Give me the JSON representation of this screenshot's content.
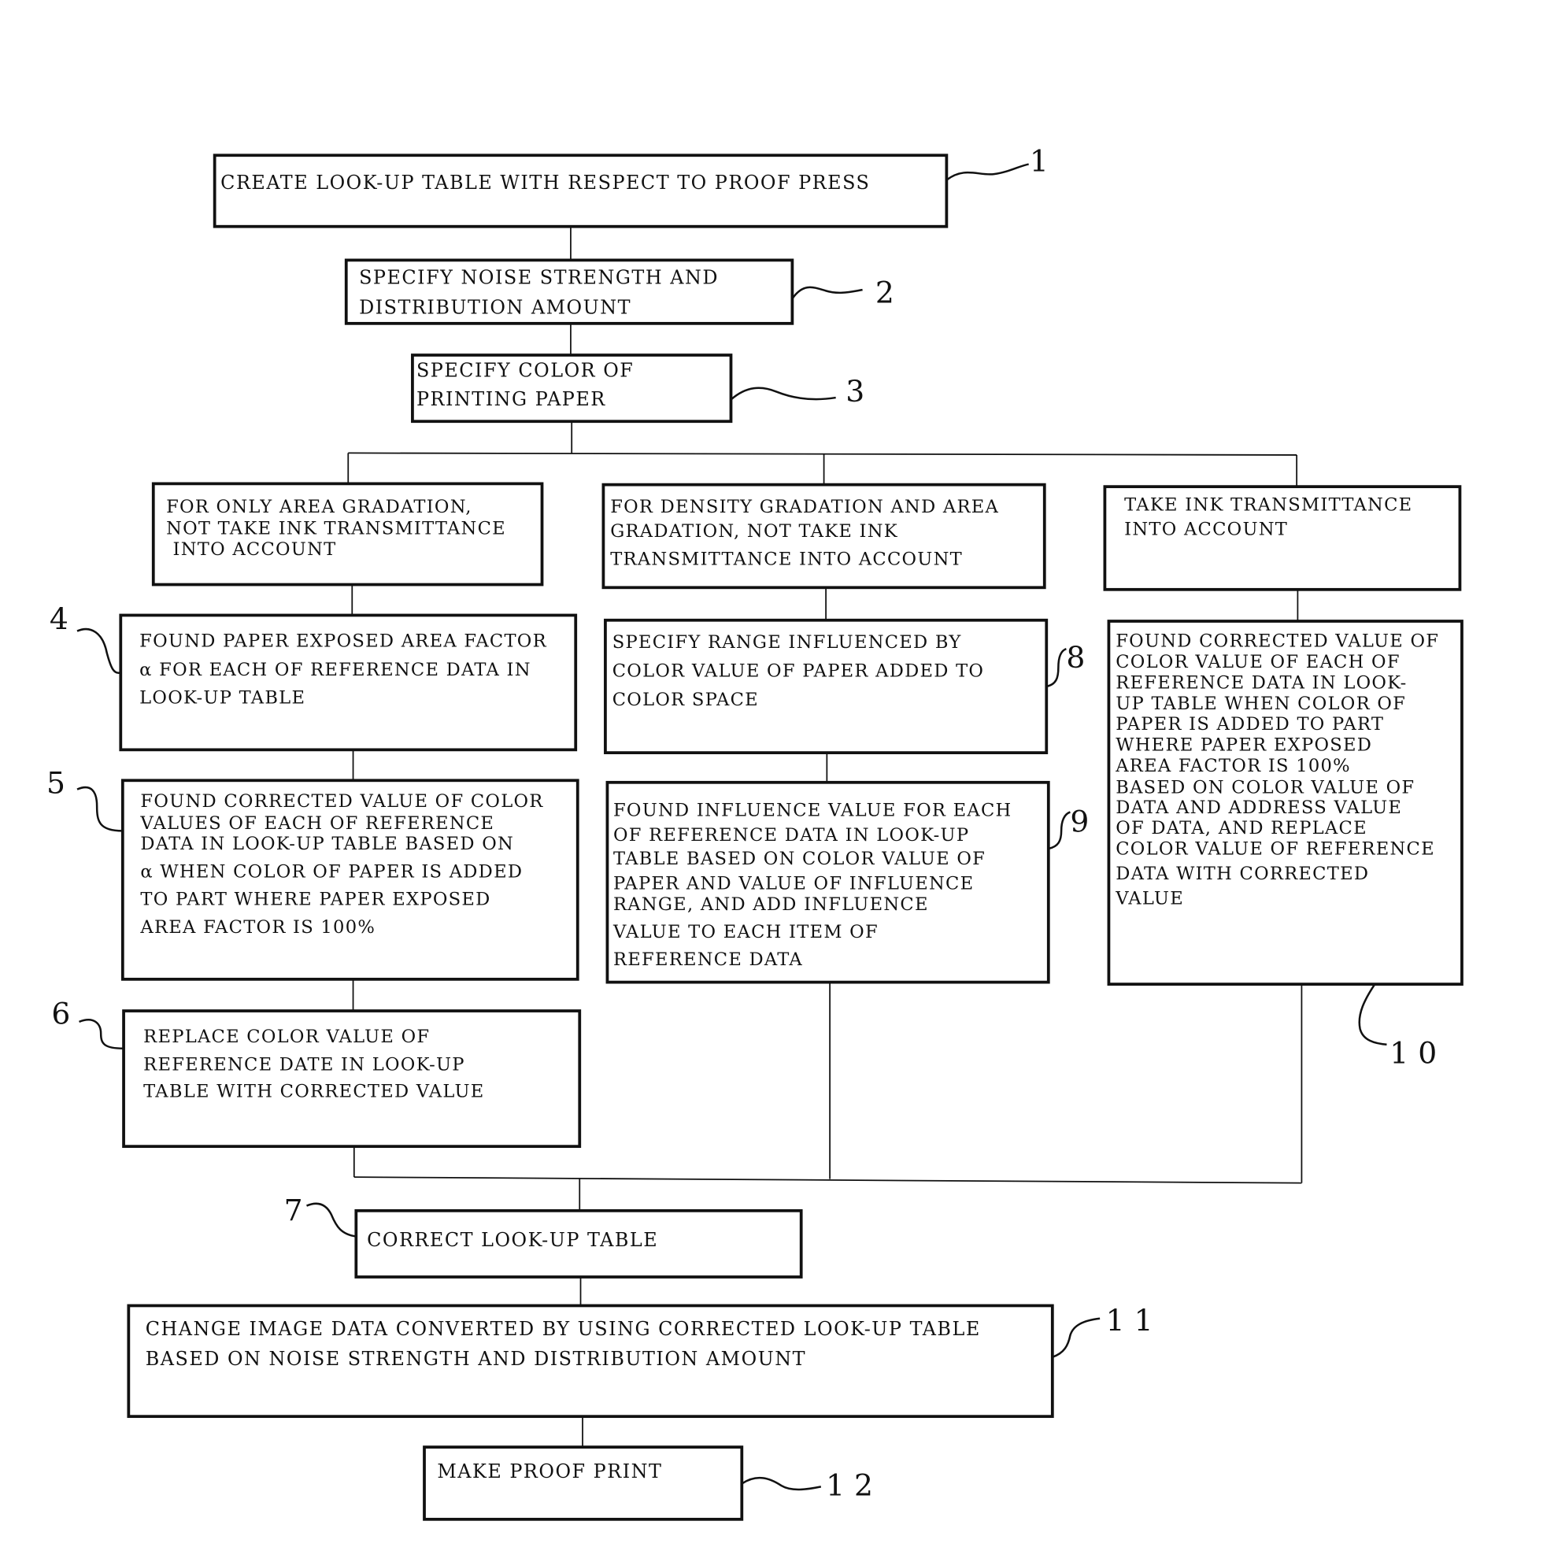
{
  "figure": {
    "steps": {
      "s1": {
        "ref": "1",
        "lines": [
          "CREATE LOOK-UP TABLE WITH RESPECT TO PROOF PRESS"
        ]
      },
      "s2": {
        "ref": "2",
        "lines": [
          "SPECIFY NOISE STRENGTH AND",
          "DISTRIBUTION AMOUNT"
        ]
      },
      "s3": {
        "ref": "3",
        "lines": [
          "SPECIFY COLOR OF",
          "PRINTING PAPER"
        ]
      },
      "branchA": {
        "lines": [
          "FOR ONLY AREA GRADATION,",
          "NOT TAKE INK TRANSMITTANCE",
          " INTO ACCOUNT"
        ]
      },
      "branchB": {
        "lines": [
          "FOR DENSITY GRADATION AND AREA",
          "GRADATION, NOT TAKE INK",
          "TRANSMITTANCE INTO ACCOUNT"
        ]
      },
      "branchC": {
        "lines": [
          " TAKE INK TRANSMITTANCE",
          " INTO ACCOUNT"
        ]
      },
      "s4": {
        "ref": "4",
        "lines": [
          "FOUND PAPER EXPOSED AREA FACTOR",
          "α FOR EACH OF REFERENCE DATA IN",
          "LOOK-UP TABLE"
        ]
      },
      "s5": {
        "ref": "5",
        "lines": [
          "FOUND CORRECTED VALUE OF COLOR",
          "VALUES OF EACH OF REFERENCE",
          "DATA IN LOOK-UP TABLE BASED ON",
          "α WHEN COLOR OF PAPER IS ADDED",
          "TO PART WHERE PAPER EXPOSED",
          "AREA FACTOR IS 100%"
        ]
      },
      "s6": {
        "ref": "6",
        "lines": [
          "REPLACE COLOR VALUE OF",
          "REFERENCE DATE IN LOOK-UP",
          "TABLE WITH CORRECTED VALUE"
        ]
      },
      "s8": {
        "ref": "8",
        "lines": [
          "SPECIFY RANGE INFLUENCED BY",
          "COLOR VALUE OF PAPER ADDED TO",
          "COLOR SPACE"
        ]
      },
      "s9": {
        "ref": "9",
        "lines": [
          "FOUND INFLUENCE VALUE FOR EACH",
          "OF REFERENCE DATA IN LOOK-UP",
          "TABLE BASED ON COLOR VALUE OF",
          "PAPER AND VALUE OF INFLUENCE",
          "RANGE, AND ADD INFLUENCE",
          "VALUE TO EACH ITEM OF",
          "REFERENCE DATA"
        ]
      },
      "s10": {
        "ref": "1 0",
        "lines": [
          "FOUND CORRECTED VALUE OF",
          "COLOR VALUE OF EACH OF",
          "REFERENCE DATA IN LOOK-",
          "UP TABLE WHEN COLOR OF",
          "PAPER IS ADDED TO PART",
          "WHERE PAPER EXPOSED",
          "AREA FACTOR IS 100%",
          "BASED ON COLOR VALUE OF",
          "DATA AND ADDRESS VALUE",
          "OF DATA, AND REPLACE",
          "COLOR VALUE OF REFERENCE",
          "DATA WITH CORRECTED",
          "VALUE"
        ]
      },
      "s7": {
        "ref": "7",
        "lines": [
          "CORRECT LOOK-UP TABLE"
        ]
      },
      "s11": {
        "ref": "1 1",
        "lines": [
          "CHANGE IMAGE DATA CONVERTED BY USING CORRECTED LOOK-UP TABLE",
          "BASED ON NOISE STRENGTH AND DISTRIBUTION AMOUNT"
        ]
      },
      "s12": {
        "ref": "1 2",
        "lines": [
          "MAKE PROOF PRINT"
        ]
      }
    }
  }
}
